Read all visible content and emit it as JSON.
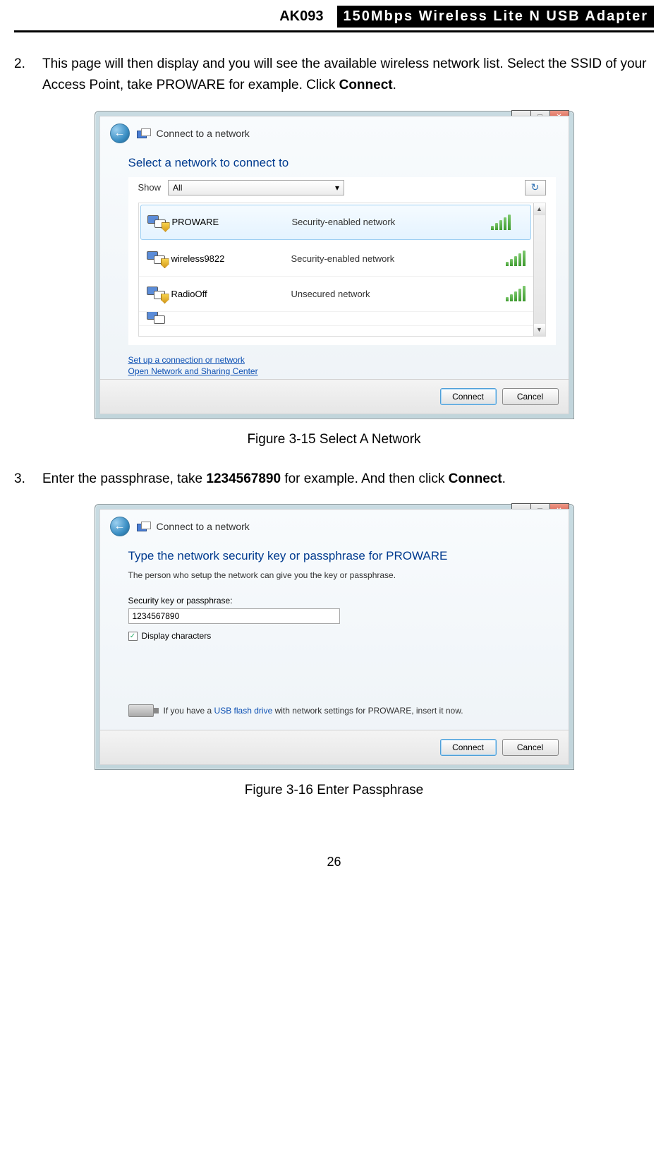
{
  "header": {
    "model": "AK093",
    "product": "150Mbps Wireless Lite N USB Adapter"
  },
  "step2": {
    "number": "2.",
    "text_before_bold": "This page will then display and you will see the available wireless network list. Select the SSID of your Access Point, take PROWARE for example. Click ",
    "bold": "Connect",
    "after": "."
  },
  "window1": {
    "title": "Connect to a network",
    "heading": "Select a network to connect to",
    "show_label": "Show",
    "show_value": "All",
    "networks": [
      {
        "name": "PROWARE",
        "desc": "Security-enabled network",
        "secured": true,
        "selected": true
      },
      {
        "name": "wireless9822",
        "desc": "Security-enabled network",
        "secured": true,
        "selected": false
      },
      {
        "name": "RadioOff",
        "desc": "Unsecured network",
        "secured": false,
        "selected": false
      }
    ],
    "link1": "Set up a connection or network",
    "link2": "Open Network and Sharing Center",
    "btn_connect": "Connect",
    "btn_cancel": "Cancel"
  },
  "caption1": "Figure 3-15 Select A Network",
  "step3": {
    "number": "3.",
    "text_before_bold1": "Enter the passphrase, take ",
    "bold1": "1234567890",
    "mid": " for example. And then click ",
    "bold2": "Connect",
    "after": "."
  },
  "window2": {
    "title": "Connect to a network",
    "heading": "Type the network security key or passphrase for PROWARE",
    "subtext": "The person who setup the network can give you the key or passphrase.",
    "field_label": "Security key or passphrase:",
    "field_value": "1234567890",
    "checkbox_label": "Display characters",
    "usb_before": "If you have a ",
    "usb_link": "USB flash drive",
    "usb_after": " with network settings for PROWARE, insert it now.",
    "btn_connect": "Connect",
    "btn_cancel": "Cancel"
  },
  "caption2": "Figure 3-16 Enter Passphrase",
  "page_number": "26"
}
